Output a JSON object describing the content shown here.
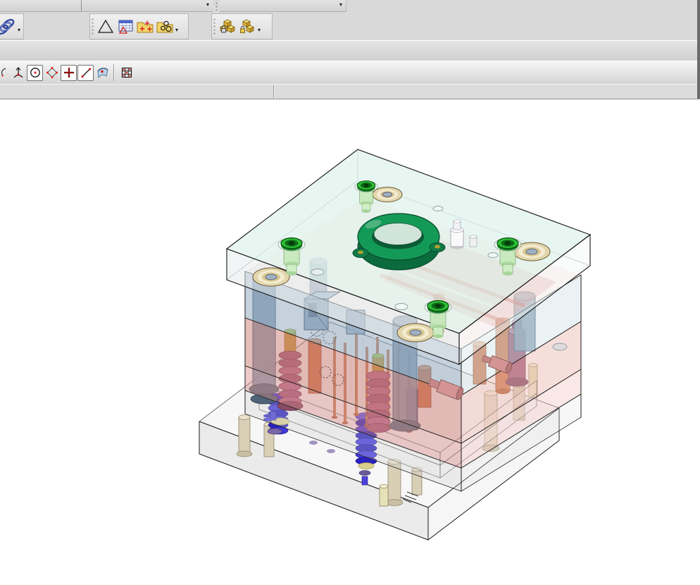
{
  "chrome": {
    "dropdown_glyph": "▾",
    "row1_slots": [
      {
        "name": "toolbar-dock-slot-left",
        "has_dropdown": false
      },
      {
        "name": "toolbar-dock-slot-middle",
        "has_dropdown": true
      },
      {
        "name": "toolbar-dock-slot-right",
        "has_dropdown": true
      }
    ],
    "toolbar_groups": [
      {
        "id": "sketch-tools",
        "icons": [
          "spring-coil-icon"
        ],
        "has_dropdown": true
      },
      {
        "id": "utility-tools",
        "icons": [
          "triangle-icon",
          "point-table-icon",
          "folder-points-icon",
          "folder-circles-icon"
        ],
        "has_dropdown": true
      },
      {
        "id": "assembly-tools",
        "icons": [
          "cubes-lock-icon",
          "cubes-stack-icon"
        ],
        "has_dropdown": true
      }
    ],
    "snap_toolbar": [
      {
        "name": "endpoint-snap-icon",
        "pressed": false
      },
      {
        "name": "normal-snap-icon",
        "pressed": false
      },
      {
        "name": "center-snap-icon",
        "pressed": true
      },
      {
        "name": "quadrant-snap-icon",
        "pressed": false
      },
      {
        "name": "intersection-snap-icon",
        "pressed": true
      },
      {
        "name": "midpoint-snap-icon",
        "pressed": true
      },
      {
        "name": "surface-snap-icon",
        "pressed": false
      },
      {
        "name": "point-grid-icon",
        "pressed": false
      }
    ]
  },
  "mold": {
    "colors": {
      "top_plate_top": "#dff2ec",
      "top_plate_left": "#e4eaec",
      "top_plate_right": "#f3f8f8",
      "a_plate_left": "#8fa6bd",
      "a_plate_right": "#cfdfe2",
      "b_plate_left": "#cc7d76",
      "b_plate_right": "#eab8b0",
      "support_left": "#d28a84",
      "support_right": "#f0c6c0",
      "rail_left": "#cccccc",
      "rail_right": "#e2e2e2",
      "bottom_left": "#dedede",
      "bottom_right": "#efefef",
      "bottom_top": "#ececec",
      "locating_ring": "#149a57",
      "locating_ring_dark": "#0b6b3c",
      "ring_hole": "#dcebe4",
      "screw_green": "#2fbe36",
      "screw_green_dark": "#0d6d16",
      "screw_boss": "#c4e9b8",
      "pillar": "#7d96ae",
      "pillar_dark": "#5a7086",
      "bushing_outer": "#e3d6ac",
      "bushing_inner": "#f3ecd2",
      "bushing_hole": "#9fb0c2",
      "spring_maroon": "#a55a7c",
      "spring_maroon_dark": "#6e3552",
      "spring_core": "#c89c38",
      "spring_cap": "#b8cc50",
      "spring_blue": "#3b32d6",
      "pin_orange": "#d0784e",
      "pin_tan": "#d9cfb6",
      "side_pin_pink": "#d49494",
      "washer_purple": "#7a68a8",
      "disc_yellow": "#e6dc96",
      "latch_steel": "#8fa6ba"
    }
  }
}
